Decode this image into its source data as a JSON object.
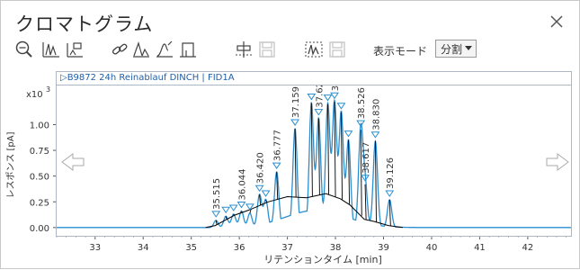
{
  "window": {
    "title": "クロマトグラム"
  },
  "toolbar": {
    "display_mode_label": "表示モード",
    "display_mode_value": "分割",
    "buttons": [
      {
        "name": "zoom-reset-icon"
      },
      {
        "name": "peak-integration-icon"
      },
      {
        "name": "baseline-icon"
      },
      {
        "name": "link-icon"
      },
      {
        "name": "peak-label-icon"
      },
      {
        "name": "peak-shape-icon"
      },
      {
        "name": "peak-start-end-icon"
      },
      {
        "name": "baseline-adjust-icon"
      },
      {
        "name": "save-icon"
      },
      {
        "name": "peak-window-icon"
      },
      {
        "name": "save-icon-2"
      }
    ]
  },
  "chart_header": {
    "label": "▷B9872 24h Reinablauf DINCH | FID1A"
  },
  "colors": {
    "trace": "#2a8fd0",
    "baseline": "#000000",
    "marker": "#2a8fd0",
    "axis_text": "#333333",
    "header_text": "#1f5fa8"
  },
  "chart_data": {
    "type": "line",
    "xlabel": "リテンションタイム [min]",
    "ylabel": "レスポンス [pA]",
    "y_multiplier": "x10 3",
    "xlim": [
      32.2,
      42.9
    ],
    "ylim": [
      -0.08,
      1.38
    ],
    "x_ticks": [
      33,
      34,
      35,
      36,
      37,
      38,
      39,
      40,
      41,
      42
    ],
    "y_ticks": [
      0.0,
      0.25,
      0.5,
      0.75,
      1.0
    ],
    "y_tick_labels": [
      "0.00",
      "0.25",
      "0.50",
      "0.75",
      "1.00"
    ],
    "grid": false,
    "peaks": [
      {
        "rt": 35.515,
        "label": "35.515",
        "height": 0.07
      },
      {
        "rt": 35.72,
        "label": "",
        "height": 0.11
      },
      {
        "rt": 35.88,
        "label": "",
        "height": 0.13
      },
      {
        "rt": 36.044,
        "label": "36.044",
        "height": 0.16
      },
      {
        "rt": 36.22,
        "label": "",
        "height": 0.14
      },
      {
        "rt": 36.42,
        "label": "36.420",
        "height": 0.32
      },
      {
        "rt": 36.55,
        "label": "",
        "height": 0.27
      },
      {
        "rt": 36.777,
        "label": "36.777",
        "height": 0.54
      },
      {
        "rt": 37.159,
        "label": "37.159",
        "height": 0.96
      },
      {
        "rt": 37.5,
        "label": "",
        "height": 1.21
      },
      {
        "rt": 37.65,
        "label": "37.620",
        "height": 1.06
      },
      {
        "rt": 37.84,
        "label": "",
        "height": 1.2
      },
      {
        "rt": 37.98,
        "label": "37.9",
        "height": 1.22
      },
      {
        "rt": 38.12,
        "label": "",
        "height": 1.12
      },
      {
        "rt": 38.27,
        "label": "",
        "height": 0.85
      },
      {
        "rt": 38.526,
        "label": "38.526",
        "height": 0.95
      },
      {
        "rt": 38.617,
        "label": "38.617",
        "height": 0.42
      },
      {
        "rt": 38.83,
        "label": "38.830",
        "height": 0.84
      },
      {
        "rt": 39.126,
        "label": "39.126",
        "height": 0.27
      }
    ],
    "baseline_points": [
      [
        35.3,
        0.0
      ],
      [
        35.5,
        0.02
      ],
      [
        35.9,
        0.12
      ],
      [
        36.2,
        0.17
      ],
      [
        36.6,
        0.25
      ],
      [
        37.0,
        0.3
      ],
      [
        37.4,
        0.29
      ],
      [
        37.8,
        0.33
      ],
      [
        38.1,
        0.28
      ],
      [
        38.3,
        0.22
      ],
      [
        38.6,
        0.08
      ],
      [
        38.8,
        0.06
      ],
      [
        39.1,
        0.02
      ],
      [
        39.4,
        0.0
      ]
    ]
  }
}
